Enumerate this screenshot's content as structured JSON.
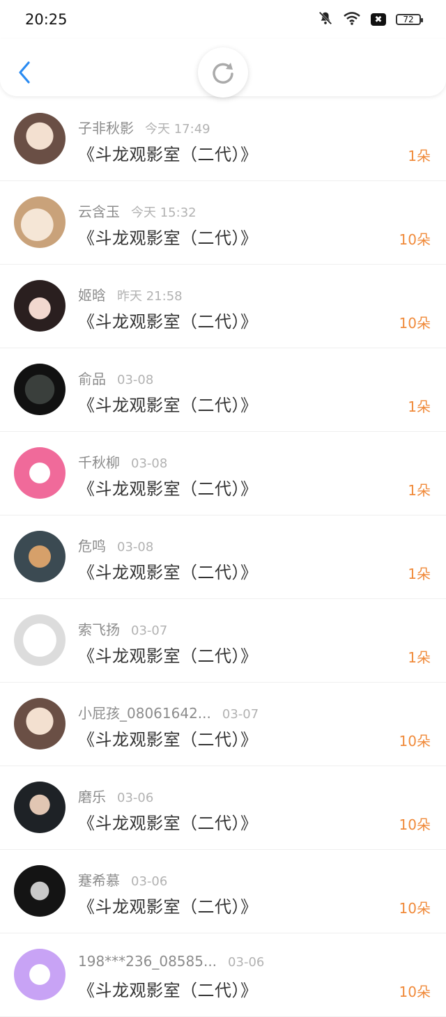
{
  "status_bar": {
    "time": "20:25",
    "icons": [
      "bell-muted-icon",
      "wifi-icon",
      "sim-off-icon",
      "battery-icon"
    ],
    "battery": "72",
    "sim_badge": "✖"
  },
  "header": {
    "back_icon": "chevron-left-icon",
    "refresh_icon": "refresh-icon",
    "accent_color": "#2a8bf2"
  },
  "colors": {
    "name": "#8c8c8c",
    "time": "#b2b2b2",
    "title": "#333333",
    "amount": "#f08a3a"
  },
  "items": [
    {
      "name": "子非秋影",
      "time": "今天 17:49",
      "title": "《斗龙观影室（二代）》",
      "amount": "1朵"
    },
    {
      "name": "云含玉",
      "time": "今天 15:32",
      "title": "《斗龙观影室（二代）》",
      "amount": "10朵"
    },
    {
      "name": "姬晗",
      "time": "昨天 21:58",
      "title": "《斗龙观影室（二代）》",
      "amount": "10朵"
    },
    {
      "name": "俞品",
      "time": "03-08",
      "title": "《斗龙观影室（二代）》",
      "amount": "1朵"
    },
    {
      "name": "千秋柳",
      "time": "03-08",
      "title": "《斗龙观影室（二代）》",
      "amount": "1朵"
    },
    {
      "name": "危鸣",
      "time": "03-08",
      "title": "《斗龙观影室（二代）》",
      "amount": "1朵"
    },
    {
      "name": "索飞扬",
      "time": "03-07",
      "title": "《斗龙观影室（二代）》",
      "amount": "1朵"
    },
    {
      "name": "小屁孩_08061642...",
      "time": "03-07",
      "title": "《斗龙观影室（二代）》",
      "amount": "10朵"
    },
    {
      "name": "磨乐",
      "time": "03-06",
      "title": "《斗龙观影室（二代）》",
      "amount": "10朵"
    },
    {
      "name": "蹇希慕",
      "time": "03-06",
      "title": "《斗龙观影室（二代）》",
      "amount": "10朵"
    },
    {
      "name": "198***236_08585...",
      "time": "03-06",
      "title": "《斗龙观影室（二代）》",
      "amount": "10朵"
    }
  ]
}
